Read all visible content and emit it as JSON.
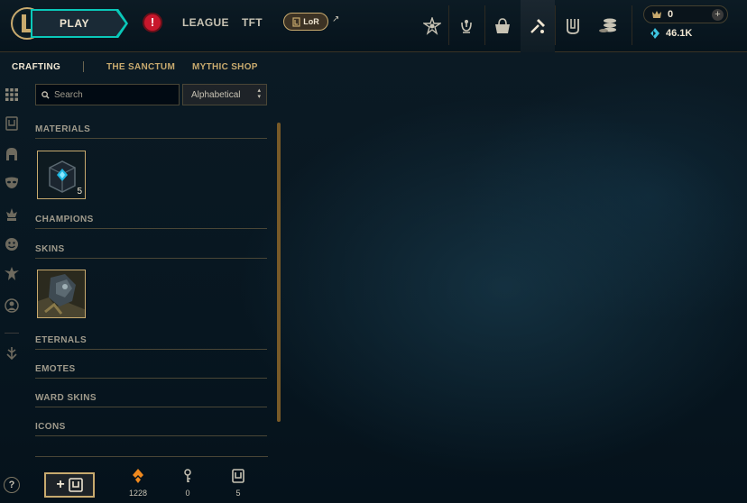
{
  "topbar": {
    "play_label": "PLAY",
    "alert_glyph": "!",
    "nav": [
      {
        "label": "LEAGUE"
      },
      {
        "label": "TFT"
      }
    ],
    "lor_label": "LoR",
    "lor_arrow": "↗",
    "icons": [
      "rank-emblem-icon",
      "honor-icon",
      "store-bag-icon",
      "crafting-hammer-icon",
      "collection-icon",
      "loot-coins-icon"
    ],
    "wallet": {
      "rp_value": "0",
      "plus": "+",
      "be_value": "46.1K"
    }
  },
  "subnav": {
    "items": [
      {
        "label": "CRAFTING"
      },
      {
        "label": "THE SANCTUM"
      },
      {
        "label": "MYTHIC SHOP"
      }
    ]
  },
  "rail": {
    "icons": [
      "grid-icon",
      "chest-icon",
      "helmet-icon",
      "mask-icon",
      "ward-icon",
      "emote-face-icon",
      "eternal-icon",
      "summoner-icon-icon",
      "arrow-down-icon"
    ],
    "help": "?"
  },
  "panel": {
    "search": {
      "placeholder": "Search",
      "value": ""
    },
    "sort": {
      "value": "Alphabetical"
    },
    "sections": [
      {
        "title": "MATERIALS"
      },
      {
        "title": "CHAMPIONS"
      },
      {
        "title": "SKINS"
      },
      {
        "title": "ETERNALS"
      },
      {
        "title": "EMOTES"
      },
      {
        "title": "WARD SKINS"
      },
      {
        "title": "ICONS"
      }
    ],
    "materials_items": [
      {
        "name": "Hextech Chest",
        "count": "5"
      }
    ],
    "skins_items": [
      {
        "name": "Skin Shard"
      }
    ]
  },
  "footer": {
    "add_label": "+",
    "currencies": [
      {
        "icon": "orange-essence-icon",
        "value": "1228"
      },
      {
        "icon": "key-icon",
        "value": "0"
      },
      {
        "icon": "chest-icon",
        "value": "5"
      }
    ]
  },
  "colors": {
    "gold": "#c8aa6e",
    "teal": "#0ac8b9",
    "text": "#a09b8c",
    "bright": "#f0e6d2",
    "background": "#010a13"
  }
}
